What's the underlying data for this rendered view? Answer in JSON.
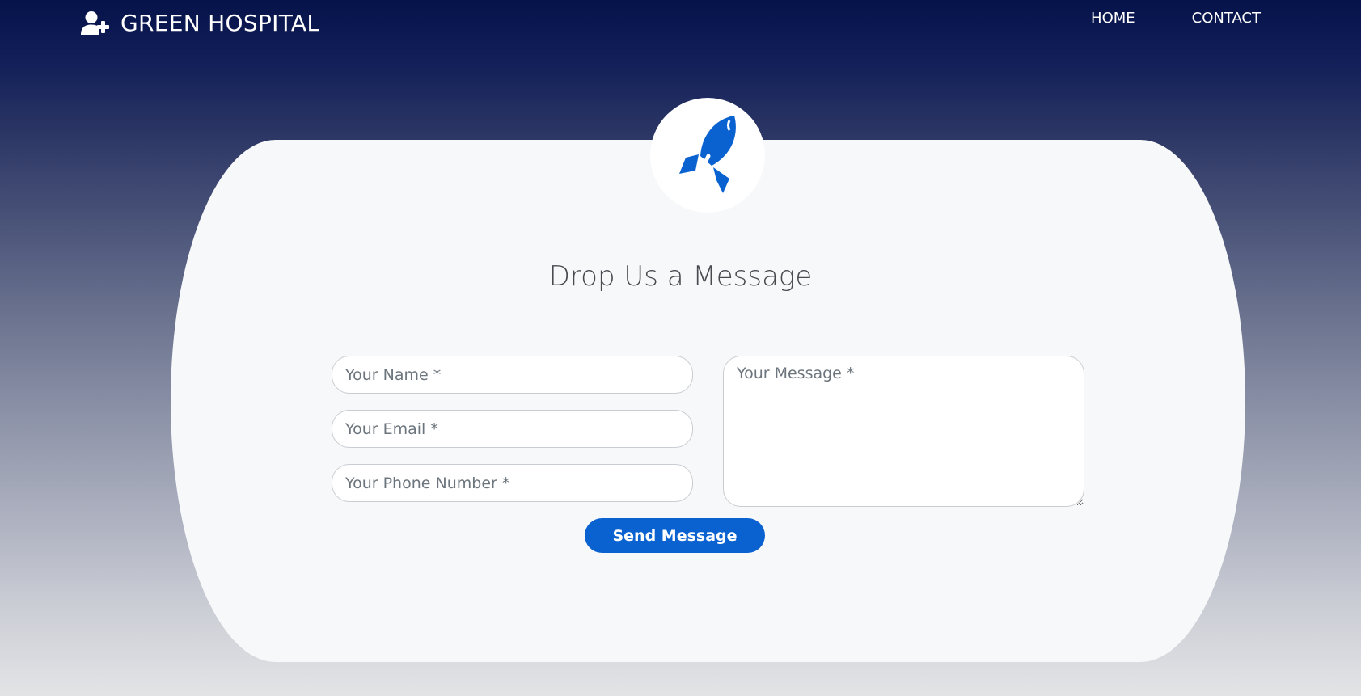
{
  "brand": {
    "name": "GREEN HOSPITAL",
    "icon": "user-plus-icon"
  },
  "nav": {
    "items": [
      {
        "label": "HOME"
      },
      {
        "label": "CONTACT"
      }
    ]
  },
  "contact_form": {
    "icon": "rocket-icon",
    "title": "Drop Us a Message",
    "name_placeholder": "Your Name *",
    "email_placeholder": "Your Email *",
    "phone_placeholder": "Your Phone Number *",
    "message_placeholder": "Your Message *",
    "submit_label": "Send Message"
  },
  "colors": {
    "accent": "#0a62d0",
    "header_dark": "#06124a",
    "card_bg": "#f7f8fa"
  }
}
